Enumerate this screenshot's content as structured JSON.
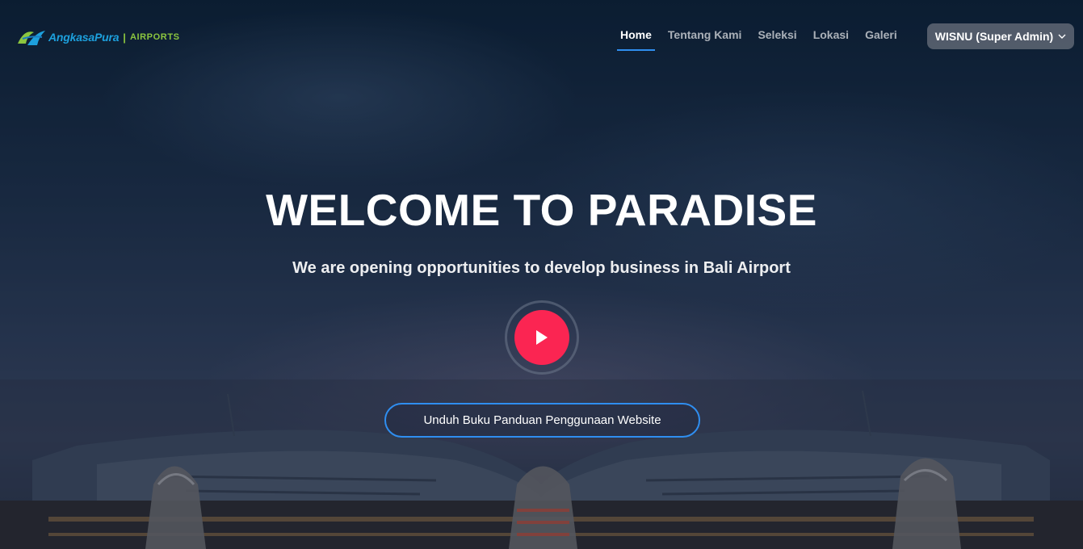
{
  "header": {
    "logo": {
      "brand": "AngkasaPura",
      "separator": "|",
      "suffix": "AIRPORTS",
      "brand_color": "#1da0dd",
      "suffix_color": "#8cc63f"
    },
    "nav": [
      {
        "label": "Home",
        "active": true
      },
      {
        "label": "Tentang Kami",
        "active": false
      },
      {
        "label": "Seleksi",
        "active": false
      },
      {
        "label": "Lokasi",
        "active": false
      },
      {
        "label": "Galeri",
        "active": false
      }
    ],
    "user_menu": {
      "label": "WISNU (Super Admin)",
      "icon": "chevron-down-icon"
    }
  },
  "hero": {
    "title": "WELCOME TO PARADISE",
    "subtitle": "We are opening opportunities to develop business in Bali Airport",
    "play_icon": "play-icon",
    "download_label": "Unduh Buku Panduan Penggunaan Website"
  },
  "colors": {
    "accent": "#2f8ef0",
    "play": "#fb2552",
    "background": "#0b1c33"
  }
}
